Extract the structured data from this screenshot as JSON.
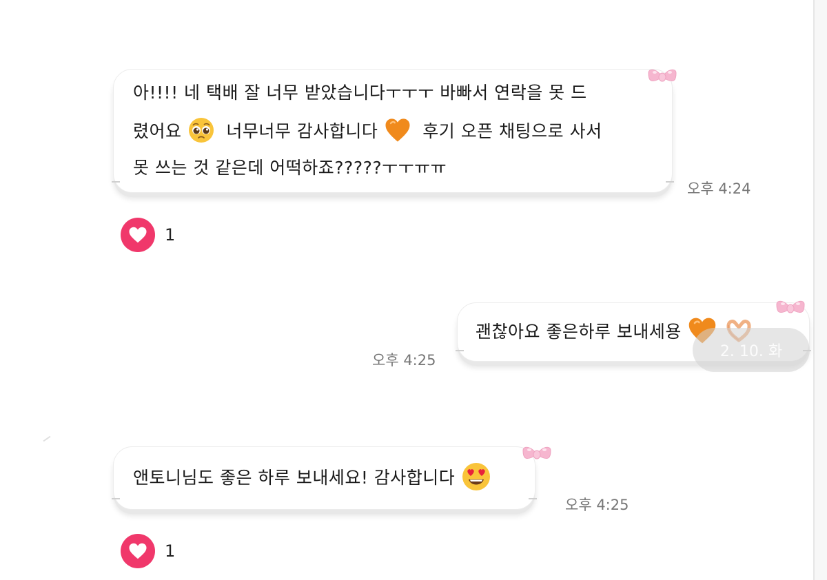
{
  "messages": [
    {
      "lines": [
        "아!!!! 네 택배 잘 너무 받았습니다ㅜㅜㅜ 바빠서 연락을 못 드",
        "렸어요",
        "너무너무 감사합니다",
        "후기 오픈 채팅으로 사서",
        "못 쓰는 것 같은데 어떡하죠?????ㅜㅜㅠㅠ"
      ],
      "time": "오후 4:24",
      "reaction_count": "1"
    },
    {
      "text": "괜찮아요 좋은하루 보내세용",
      "time": "오후 4:25"
    },
    {
      "text": "앤토니님도 좋은 하루 보내세요! 감사합니다",
      "time": "오후 4:25",
      "reaction_count": "1"
    }
  ],
  "date_overlay": "2. 10. 화",
  "icons": {
    "bow": "pink-bow-icon",
    "reaction": "heart-icon",
    "emoji_pleading": "pleading-face-emoji",
    "emoji_heart": "orange-heart-emoji",
    "emoji_hands": "heart-hands-emoji",
    "emoji_hearteyes": "heart-eyes-emoji"
  },
  "colors": {
    "reaction_pink": "#f0386b",
    "bow_pink": "#f6b6cf",
    "orange_heart": "#f08a1c",
    "emoji_yellow": "#f9c43a"
  }
}
